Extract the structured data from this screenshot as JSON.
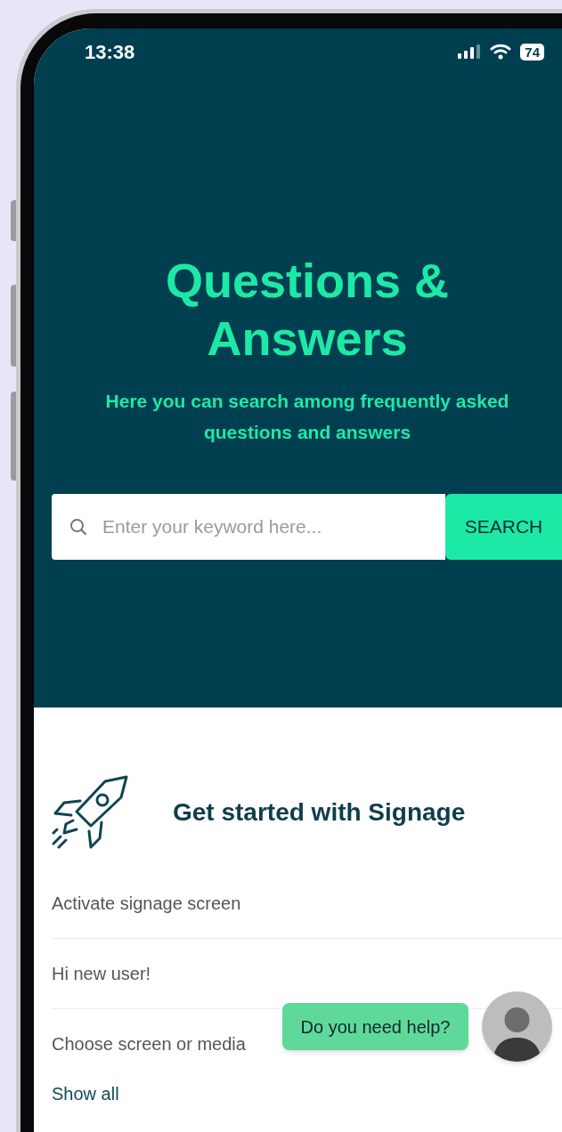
{
  "status_bar": {
    "time": "13:38",
    "battery": "74"
  },
  "hero": {
    "title": "Questions & Answers",
    "subtitle": "Here you can search among frequently asked questions and answers"
  },
  "search": {
    "placeholder": "Enter your keyword here...",
    "button": "SEARCH"
  },
  "section": {
    "title": "Get started with Signage",
    "items": [
      "Activate signage screen",
      "Hi new user!",
      "Choose screen or media"
    ],
    "link": "Show all"
  },
  "chat": {
    "message": "Do you need help?"
  }
}
